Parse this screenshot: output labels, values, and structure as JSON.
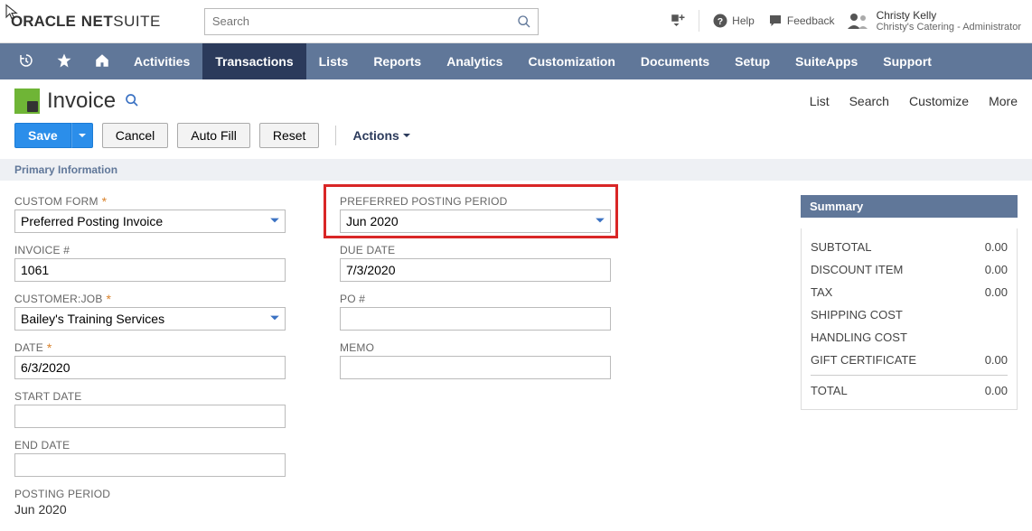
{
  "header": {
    "logo_oracle": "ORACLE",
    "logo_netsuite": "NETSUITE",
    "search_placeholder": "Search",
    "help_label": "Help",
    "feedback_label": "Feedback",
    "user_name": "Christy Kelly",
    "user_role": "Christy's Catering - Administrator"
  },
  "nav": {
    "items": [
      "Activities",
      "Transactions",
      "Lists",
      "Reports",
      "Analytics",
      "Customization",
      "Documents",
      "Setup",
      "SuiteApps",
      "Support"
    ],
    "active_index": 1
  },
  "page": {
    "title": "Invoice",
    "right_links": [
      "List",
      "Search",
      "Customize",
      "More"
    ]
  },
  "actions": {
    "save": "Save",
    "cancel": "Cancel",
    "autofill": "Auto Fill",
    "reset": "Reset",
    "actions_menu": "Actions"
  },
  "section": {
    "primary_info": "Primary Information"
  },
  "form": {
    "custom_form_label": "CUSTOM FORM",
    "custom_form_value": "Preferred Posting Invoice",
    "invoice_num_label": "INVOICE #",
    "invoice_num_value": "1061",
    "customer_label": "CUSTOMER:JOB",
    "customer_value": "Bailey's Training Services",
    "date_label": "DATE",
    "date_value": "6/3/2020",
    "start_date_label": "START DATE",
    "start_date_value": "",
    "end_date_label": "END DATE",
    "end_date_value": "",
    "posting_period_label": "POSTING PERIOD",
    "posting_period_value": "Jun 2020",
    "pref_posting_label": "PREFERRED POSTING PERIOD",
    "pref_posting_value": "Jun 2020",
    "due_date_label": "DUE DATE",
    "due_date_value": "7/3/2020",
    "po_label": "PO #",
    "po_value": "",
    "memo_label": "MEMO",
    "memo_value": ""
  },
  "summary": {
    "title": "Summary",
    "rows": [
      {
        "label": "SUBTOTAL",
        "value": "0.00"
      },
      {
        "label": "DISCOUNT ITEM",
        "value": "0.00"
      },
      {
        "label": "TAX",
        "value": "0.00"
      },
      {
        "label": "SHIPPING COST",
        "value": ""
      },
      {
        "label": "HANDLING COST",
        "value": ""
      },
      {
        "label": "GIFT CERTIFICATE",
        "value": "0.00"
      }
    ],
    "total_label": "TOTAL",
    "total_value": "0.00"
  }
}
